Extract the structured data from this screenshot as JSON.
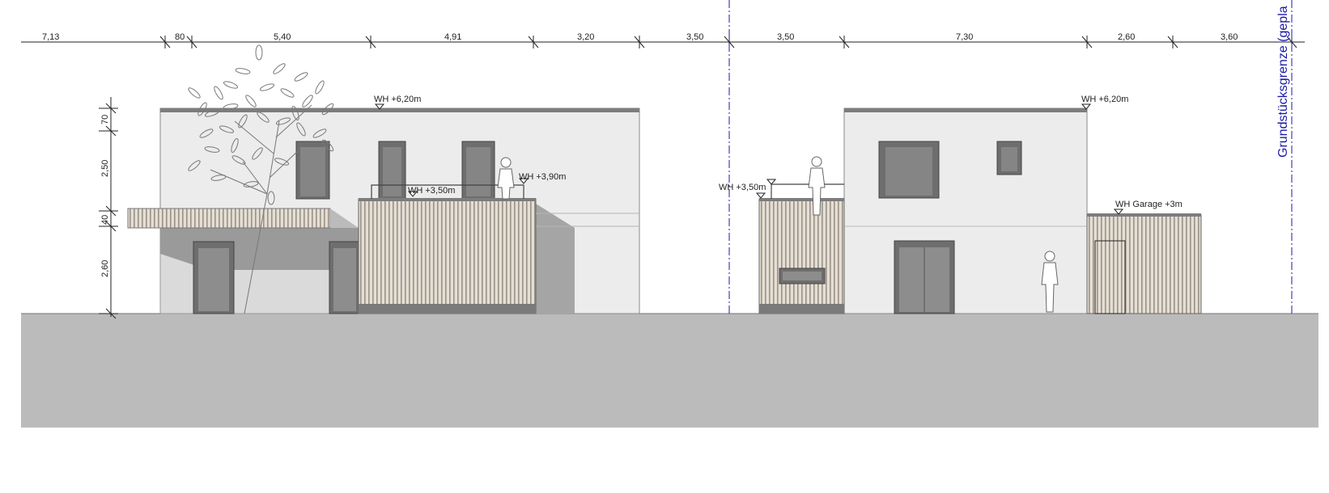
{
  "dimensions": {
    "top_left": [
      "7,13",
      "80",
      "5,40",
      "4,91",
      "3,20",
      "3,50"
    ],
    "top_right": [
      "3,50",
      "7,30",
      "2,60",
      "3,60"
    ],
    "vertical": [
      "70",
      "2,50",
      "40",
      "2,60"
    ]
  },
  "levels": {
    "left_roof": "WH +6,20m",
    "left_terrace": "WH +3,90m",
    "left_box": "WH +3,50m",
    "right_roof": "WH +6,20m",
    "right_annex": "WH +3,50m",
    "right_garage": "WH Garage +3m"
  },
  "boundary_label": "Grundstücksgrenze (gepla",
  "colors": {
    "ground": "#bbbbbb",
    "wall": "#ececec",
    "window": "#6e6e6e",
    "boundary": "#1a1aa8",
    "cladding": "#d9d2c6"
  }
}
